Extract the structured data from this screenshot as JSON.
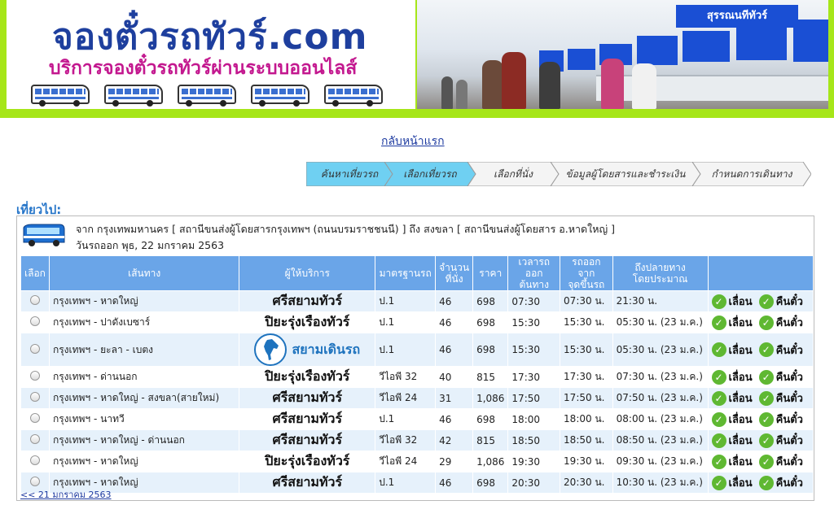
{
  "header": {
    "logo_title": "จองตั๋วรถทัวร์.com",
    "logo_subtitle": "บริการจองตั๋วรถทัวร์ผ่านระบบออนไลส์",
    "photo_sign": "สุรรณนทีทัวร์"
  },
  "nav": {
    "back_home": "กลับหน้าแรก"
  },
  "steps": [
    {
      "label": "ค้นหาเที่ยวรถ",
      "state": "done"
    },
    {
      "label": "เลือกเที่ยวรถ",
      "state": "current"
    },
    {
      "label": "เลือกที่นั่ง",
      "state": "pending"
    },
    {
      "label": "ข้อมูลผู้โดยสารและชำระเงิน",
      "state": "pending"
    },
    {
      "label": "กำหนดการเดินทาง",
      "state": "pending"
    }
  ],
  "section_label": "เที่ยวไป:",
  "trip": {
    "route": "จาก กรุงเทพมหานคร [ สถานีขนส่งผู้โดยสารกรุงเทพฯ (ถนนบรมราชชนนี) ] ถึง สงขลา [ สถานีขนส่งผู้โดยสาร อ.หาดใหญ่ ]",
    "date": "วันรถออก พุธ, 22 มกราคม 2563"
  },
  "table": {
    "headers": {
      "select": "เลือก",
      "route": "เส้นทาง",
      "operator": "ผู้ให้บริการ",
      "standard": "มาตรฐานรถ",
      "seats_1": "จำนวน",
      "seats_2": "ที่นั่ง",
      "price": "ราคา",
      "depart_1": "เวลารถออก",
      "depart_2": "ต้นทาง",
      "pickup_1": "รถออกจาก",
      "pickup_2": "จุดขึ้นรถ",
      "arrive_1": "ถึงปลายทาง",
      "arrive_2": "โดยประมาณ"
    },
    "rows": [
      {
        "route": "กรุงเทพฯ - หาดใหญ่",
        "operator": "ศรีสยามทัวร์",
        "logo": false,
        "standard": "ป.1",
        "seats": "46",
        "price": "698",
        "depart": "07:30",
        "pickup": "07:30 น.",
        "arrive": "21:30 น."
      },
      {
        "route": "กรุงเทพฯ - ปาดังเบซาร์",
        "operator": "ปิยะรุ่งเรืองทัวร์",
        "logo": false,
        "standard": "ป.1",
        "seats": "46",
        "price": "698",
        "depart": "15:30",
        "pickup": "15:30 น.",
        "arrive": "05:30 น. (23 ม.ค.)"
      },
      {
        "route": "กรุงเทพฯ - ยะลา - เบตง",
        "operator": "สยามเดินรถ",
        "logo": true,
        "standard": "ป.1",
        "seats": "46",
        "price": "698",
        "depart": "15:30",
        "pickup": "15:30 น.",
        "arrive": "05:30 น. (23 ม.ค.)"
      },
      {
        "route": "กรุงเทพฯ - ด่านนอก",
        "operator": "ปิยะรุ่งเรืองทัวร์",
        "logo": false,
        "standard": "วีไอพี 32",
        "seats": "40",
        "price": "815",
        "depart": "17:30",
        "pickup": "17:30 น.",
        "arrive": "07:30 น. (23 ม.ค.)"
      },
      {
        "route": "กรุงเทพฯ - หาดใหญ่ - สงขลา(สายใหม่)",
        "operator": "ศรีสยามทัวร์",
        "logo": false,
        "standard": "วีไอพี 24",
        "seats": "31",
        "price": "1,086",
        "depart": "17:50",
        "pickup": "17:50 น.",
        "arrive": "07:50 น. (23 ม.ค.)"
      },
      {
        "route": "กรุงเทพฯ - นาทวี",
        "operator": "ศรีสยามทัวร์",
        "logo": false,
        "standard": "ป.1",
        "seats": "46",
        "price": "698",
        "depart": "18:00",
        "pickup": "18:00 น.",
        "arrive": "08:00 น. (23 ม.ค.)"
      },
      {
        "route": "กรุงเทพฯ - หาดใหญ่ - ด่านนอก",
        "operator": "ศรีสยามทัวร์",
        "logo": false,
        "standard": "วีไอพี 32",
        "seats": "42",
        "price": "815",
        "depart": "18:50",
        "pickup": "18:50 น.",
        "arrive": "08:50 น. (23 ม.ค.)"
      },
      {
        "route": "กรุงเทพฯ - หาดใหญ่",
        "operator": "ปิยะรุ่งเรืองทัวร์",
        "logo": false,
        "standard": "วีไอพี 24",
        "seats": "29",
        "price": "1,086",
        "depart": "19:30",
        "pickup": "19:30 น.",
        "arrive": "09:30 น. (23 ม.ค.)"
      },
      {
        "route": "กรุงเทพฯ - หาดใหญ่",
        "operator": "ศรีสยามทัวร์",
        "logo": false,
        "standard": "ป.1",
        "seats": "46",
        "price": "698",
        "depart": "20:30",
        "pickup": "20:30 น.",
        "arrive": "10:30 น. (23 ม.ค.)"
      }
    ],
    "actions": {
      "postpone": "เลื่อน",
      "refund": "คืนตั๋ว"
    }
  },
  "prev_day": "<< 21 มกราคม 2563",
  "colors": {
    "banner_green": "#a6e619",
    "header_blue": "#6aa5e8",
    "step_active": "#6fd0f2",
    "check_green": "#5fb832"
  }
}
